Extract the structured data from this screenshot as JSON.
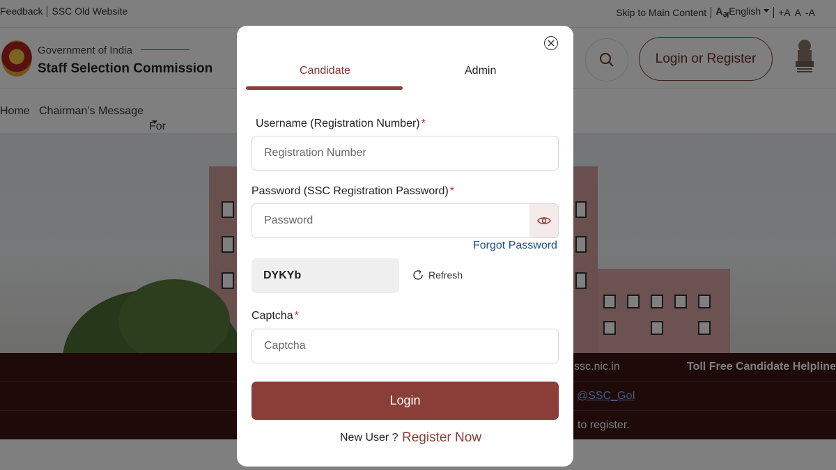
{
  "topbar": {
    "feedback": "Feedback",
    "old_site": "SSC Old Website",
    "skip": "Skip to Main Content",
    "lang_glyph": "A",
    "lang_glyph_sub": "अ",
    "language": "English",
    "font_inc": "+A",
    "font_norm": "A",
    "font_dec": "-A"
  },
  "header": {
    "gov": "Government of India",
    "org": "Staff Selection Commission",
    "login_register": "Login or Register"
  },
  "nav": {
    "items": [
      "Home",
      "Chairman’s Message",
      "For Candidates"
    ]
  },
  "footer": {
    "site": "ssc.nic.in",
    "helpline": "Toll Free Candidate Helpline",
    "handle": "@SSC_GoI",
    "register_text": "to register."
  },
  "modal": {
    "tabs": [
      "Candidate",
      "Admin"
    ],
    "active_tab": "Candidate",
    "username_label": "Username (Registration Number)",
    "username_placeholder": "Registration Number",
    "password_label": "Password (SSC Registration Password)",
    "password_placeholder": "Password",
    "required_mark": "*",
    "forgot": "Forgot Password",
    "captcha_code": "DYKYb",
    "refresh": "Refresh",
    "captcha_label": "Captcha",
    "captcha_placeholder": "Captcha",
    "login": "Login",
    "new_user": "New User ?",
    "register_now": "Register Now"
  },
  "colors": {
    "accent": "#8b3d37",
    "link": "#1a4fa0",
    "required": "#c0282b",
    "footer_bg": "#3a1513"
  },
  "icons": [
    "close-icon",
    "eye-icon",
    "refresh-icon",
    "search-icon",
    "ssc-logo",
    "national-emblem"
  ]
}
